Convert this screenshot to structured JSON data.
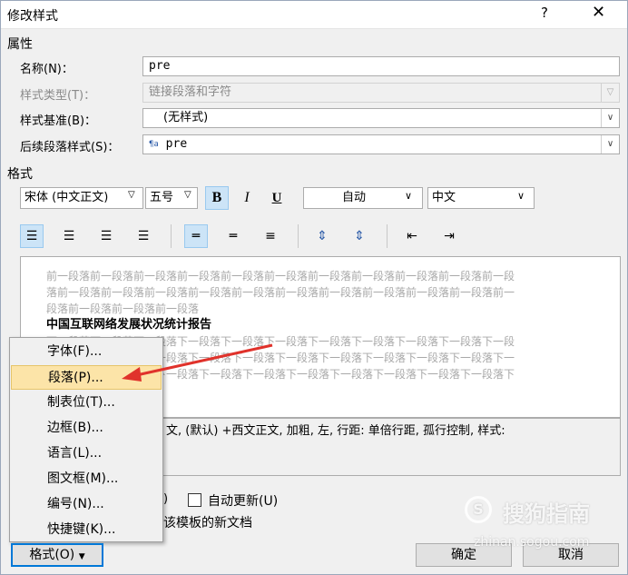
{
  "window": {
    "title": "修改样式",
    "help": "?",
    "close": "✕"
  },
  "properties": {
    "section": "属性",
    "name_label": "名称(N)：",
    "name_value": "pre",
    "type_label": "样式类型(T)：",
    "type_value": "链接段落和字符",
    "base_label": "样式基准(B)：",
    "base_value": "(无样式)",
    "next_label": "后续段落样式(S)：",
    "next_value": "pre"
  },
  "format": {
    "section": "格式",
    "font": "宋体 (中文正文)",
    "size": "五号",
    "bold": "B",
    "italic": "I",
    "underline": "U",
    "color": "自动",
    "lang": "中文"
  },
  "preview": {
    "prev_lines": [
      "前一段落前一段落前一段落前一段落前一段落前一段落前一段落前一段落前一段落前一段落前一段",
      "落前一段落前一段落前一段落前一段落前一段落前一段落前一段落前一段落前一段落前一段落前一",
      "段落前一段落前一段落前一段落"
    ],
    "sample": "中国互联网络发展状况统计报告",
    "next_lines": [
      "下一段落下一段落下一段落下一段落下一段落下一段落下一段落下一段落下一段落下一段落下一段",
      "落下一段落下一段落下一段落下一段落下一段落下一段落下一段落下一段落下一段落下一段落下一",
      "段落下一段落下一段落下一段落下一段落下一段落下一段落下一段落下一段落下一段落下一段落下"
    ]
  },
  "description": "文, (默认) +西文正文, 加粗, 左, 行距: 单倍行距, 孤行控制, 样式:",
  "options": {
    "partial_left": ")",
    "auto_update": "自动更新(U)",
    "template_text": "该模板的新文档"
  },
  "menu": {
    "items": [
      "字体(F)...",
      "段落(P)...",
      "制表位(T)...",
      "边框(B)...",
      "语言(L)...",
      "图文框(M)...",
      "编号(N)...",
      "快捷键(K)..."
    ]
  },
  "buttons": {
    "format": "格式(O)",
    "ok": "确定",
    "cancel": "取消"
  },
  "watermark": {
    "brand": "搜狗指南",
    "url": "zhinan.sogou.com"
  },
  "colors": {
    "highlight": "#fce4a8",
    "arrow": "#e0322b",
    "accent": "#0078d7"
  }
}
